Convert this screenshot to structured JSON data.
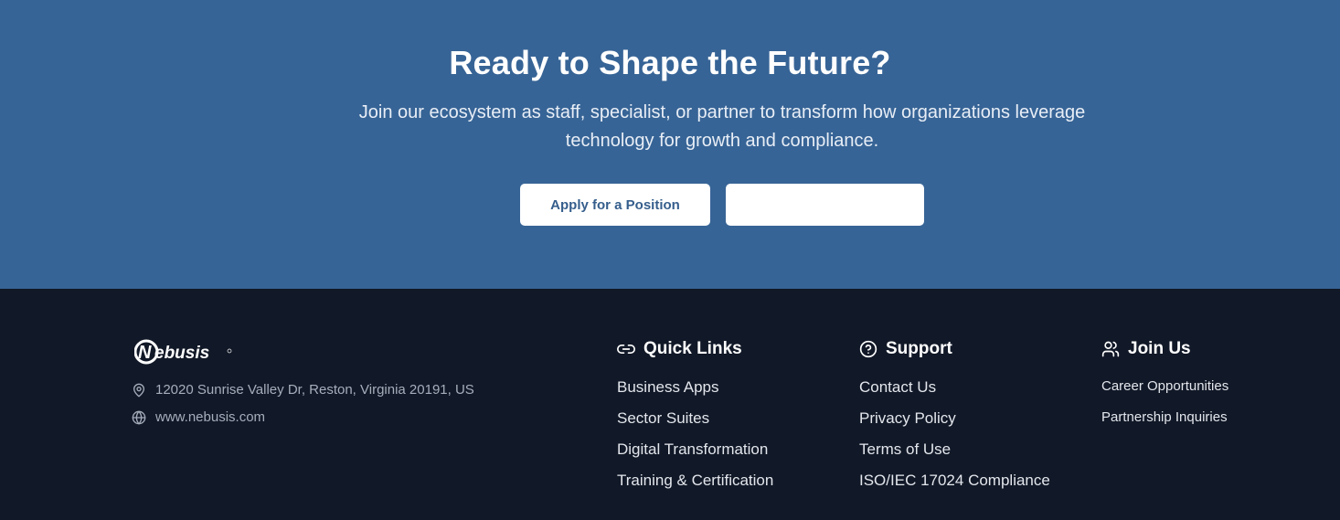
{
  "cta": {
    "title": "Ready to Shape the Future?",
    "subtitle": "Join our ecosystem as staff, specialist, or partner to transform how organizations leverage technology for growth and compliance.",
    "apply_label": "Apply for a Position",
    "partner_label": ""
  },
  "footer": {
    "logo_text": "Nebusis",
    "address": "12020 Sunrise Valley Dr, Reston, Virginia 20191, US",
    "website": "www.nebusis.com",
    "quick_links": {
      "title": "Quick Links",
      "icon": "link-icon",
      "items": [
        "Business Apps",
        "Sector Suites",
        "Digital Transformation",
        "Training & Certification"
      ]
    },
    "support": {
      "title": "Support",
      "icon": "help-circle-icon",
      "items": [
        "Contact Us",
        "Privacy Policy",
        "Terms of Use",
        "ISO/IEC 17024 Compliance"
      ]
    },
    "join_us": {
      "title": "Join Us",
      "icon": "users-icon",
      "items": [
        "Career Opportunities",
        "Partnership Inquiries"
      ]
    }
  },
  "colors": {
    "cta_background": "#376496",
    "footer_background": "#111827",
    "button_text": "#355e8c"
  }
}
